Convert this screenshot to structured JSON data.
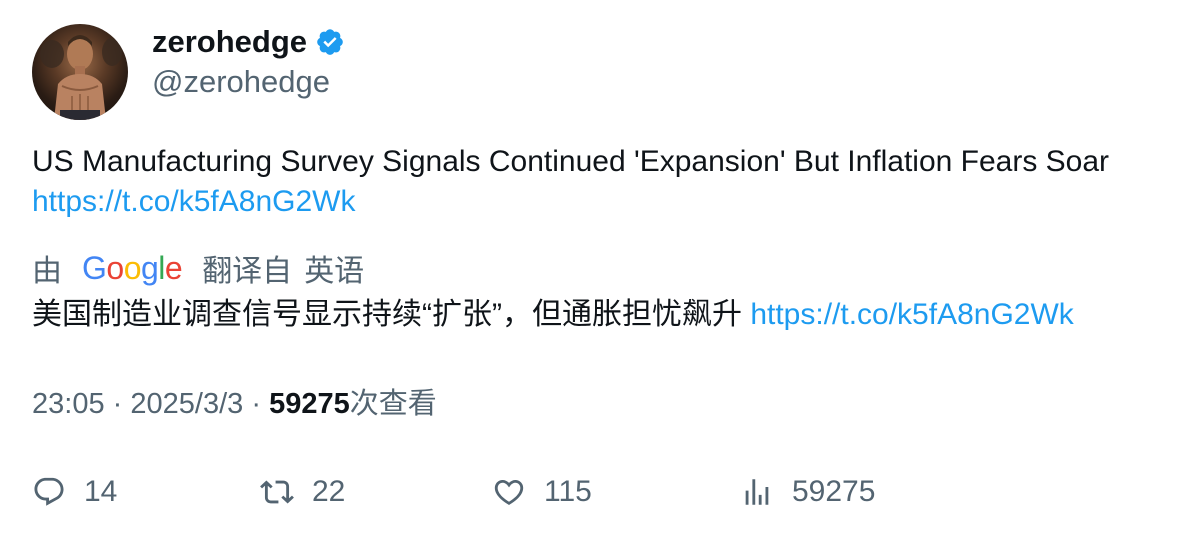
{
  "author": {
    "display_name": "zerohedge",
    "handle": "@zerohedge",
    "verified_color": "#1d9bf0"
  },
  "tweet": {
    "text": "US Manufacturing Survey Signals Continued 'Expansion' But Inflation Fears Soar ",
    "link": "https://t.co/k5fA8nG2Wk"
  },
  "translation": {
    "by": "由",
    "provider": "Google",
    "translated_from": "翻译自",
    "language": "英语",
    "text": "美国制造业调查信号显示持续“扩张”，但通胀担忧飙升 ",
    "link": "https://t.co/k5fA8nG2Wk"
  },
  "meta": {
    "time": "23:05",
    "separator": "·",
    "date": "2025/3/3",
    "views": "59275",
    "views_label": "次查看"
  },
  "actions": {
    "replies": "14",
    "retweets": "22",
    "likes": "115",
    "views": "59275"
  },
  "colors": {
    "link": "#1d9bf0",
    "secondary_text": "#536471",
    "primary_text": "#0f1419"
  }
}
